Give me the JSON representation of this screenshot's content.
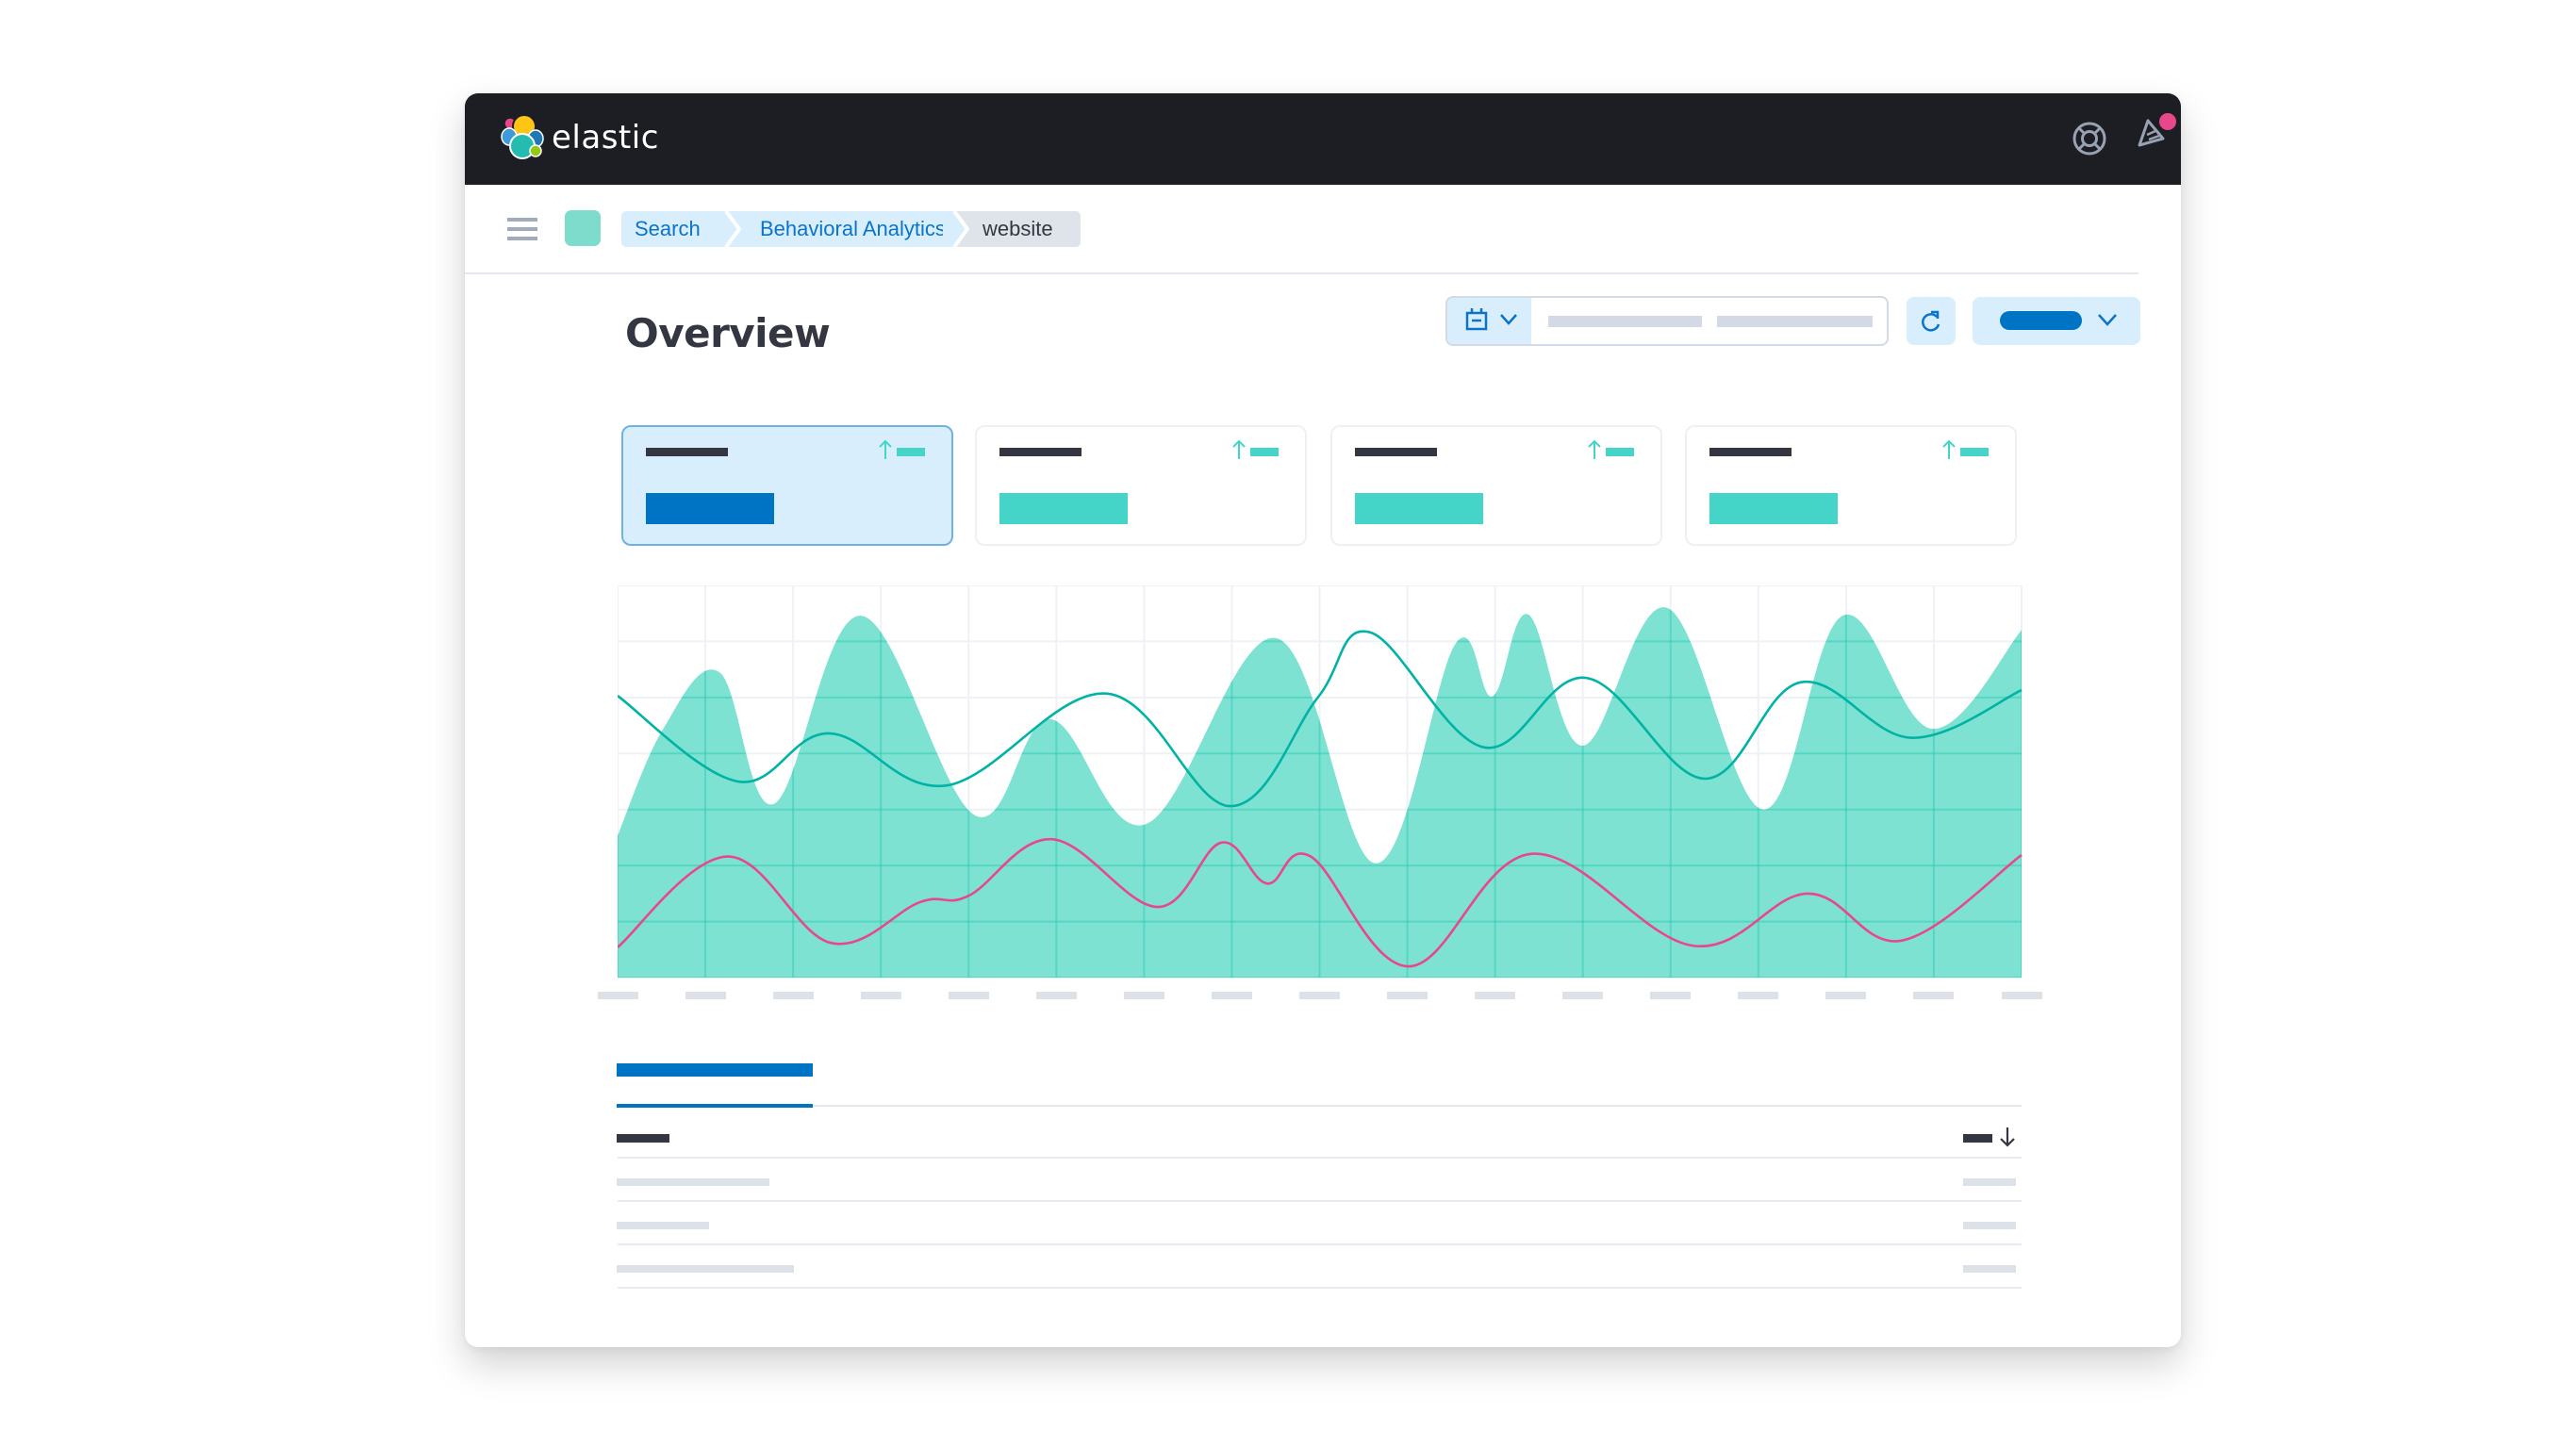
{
  "app": {
    "brand": "elastic",
    "logo_icon": "elastic-cluster-logo",
    "header_icons": [
      {
        "name": "help-lifebuoy-icon"
      },
      {
        "name": "news-feed-icon",
        "badge": true,
        "badge_color": "#e8488b"
      },
      {
        "name": "user-avatar",
        "color": "#f88a76"
      }
    ]
  },
  "nav": {
    "menu_icon": "hamburger-menu-icon",
    "space_color": "#7ddccb",
    "breadcrumbs": [
      {
        "label": "Search",
        "link": true
      },
      {
        "label": "Behavioral Analytics",
        "link": true
      },
      {
        "label": "website",
        "link": false
      }
    ]
  },
  "page": {
    "title": "Overview"
  },
  "toolbar": {
    "date_picker": {
      "quick_select_icon": "calendar-icon",
      "start_placeholder": "",
      "end_placeholder": ""
    },
    "refresh_icon": "refresh-icon",
    "update_button": {
      "chevron": "chevron-down-icon"
    }
  },
  "kpis": [
    {
      "selected": true,
      "trend": "up"
    },
    {
      "selected": false,
      "trend": "up"
    },
    {
      "selected": false,
      "trend": "up"
    },
    {
      "selected": false,
      "trend": "up"
    }
  ],
  "colors": {
    "accent": "#0074c4",
    "teal_fill": "#7de2d1",
    "teal_line": "#00b3a4",
    "pink_line": "#e8488b",
    "grid": "#eef1f6",
    "placeholder": "#dde1e8",
    "dark_text": "#343741"
  },
  "chart_data": {
    "type": "area",
    "title": "",
    "xlabel": "",
    "ylabel": "",
    "x_range": [
      0,
      16
    ],
    "y_range": [
      0,
      7
    ],
    "grid": true,
    "x_ticks": 17,
    "x_tick_labels": [
      "",
      "",
      "",
      "",
      "",
      "",
      "",
      "",
      "",
      "",
      "",
      "",
      "",
      "",
      "",
      "",
      ""
    ],
    "series": [
      {
        "name": "area-series",
        "kind": "area",
        "color": "#7de2d1",
        "points": [
          [
            0,
            2.53
          ],
          [
            0.52,
            4.44
          ],
          [
            1.16,
            5.45
          ],
          [
            1.78,
            3.1
          ],
          [
            2.77,
            6.46
          ],
          [
            4.07,
            2.9
          ],
          [
            4.93,
            4.61
          ],
          [
            6.02,
            2.74
          ],
          [
            7.5,
            6.06
          ],
          [
            8.64,
            2.04
          ],
          [
            9.55,
            5.96
          ],
          [
            9.97,
            5.02
          ],
          [
            10.38,
            6.48
          ],
          [
            11.0,
            4.14
          ],
          [
            11.96,
            6.6
          ],
          [
            13.06,
            3.0
          ],
          [
            13.96,
            6.46
          ],
          [
            14.98,
            4.44
          ],
          [
            16,
            6.2
          ]
        ]
      },
      {
        "name": "teal-line-series",
        "kind": "line",
        "color": "#00b3a4",
        "points": [
          [
            0,
            5.03
          ],
          [
            1.37,
            3.5
          ],
          [
            2.41,
            4.36
          ],
          [
            3.75,
            3.43
          ],
          [
            5.57,
            5.07
          ],
          [
            6.98,
            3.06
          ],
          [
            7.98,
            5.0
          ],
          [
            8.58,
            6.16
          ],
          [
            9.87,
            4.11
          ],
          [
            11.04,
            5.35
          ],
          [
            12.39,
            3.55
          ],
          [
            13.48,
            5.27
          ],
          [
            14.74,
            4.28
          ],
          [
            16,
            5.13
          ]
        ]
      },
      {
        "name": "pink-line-series",
        "kind": "line",
        "color": "#e8488b",
        "points": [
          [
            0,
            0.54
          ],
          [
            1.25,
            2.16
          ],
          [
            2.43,
            0.62
          ],
          [
            3.45,
            1.35
          ],
          [
            4.0,
            1.46
          ],
          [
            4.95,
            2.47
          ],
          [
            6.15,
            1.26
          ],
          [
            6.88,
            2.41
          ],
          [
            7.4,
            1.68
          ],
          [
            7.9,
            2.16
          ],
          [
            9.02,
            0.2
          ],
          [
            10.42,
            2.21
          ],
          [
            12.25,
            0.57
          ],
          [
            13.56,
            1.5
          ],
          [
            14.63,
            0.66
          ],
          [
            16,
            2.19
          ]
        ]
      }
    ]
  },
  "table": {
    "tabs": [
      {
        "label": "",
        "active": true
      }
    ],
    "sort_icon": "arrow-down-icon",
    "rows": 3
  }
}
